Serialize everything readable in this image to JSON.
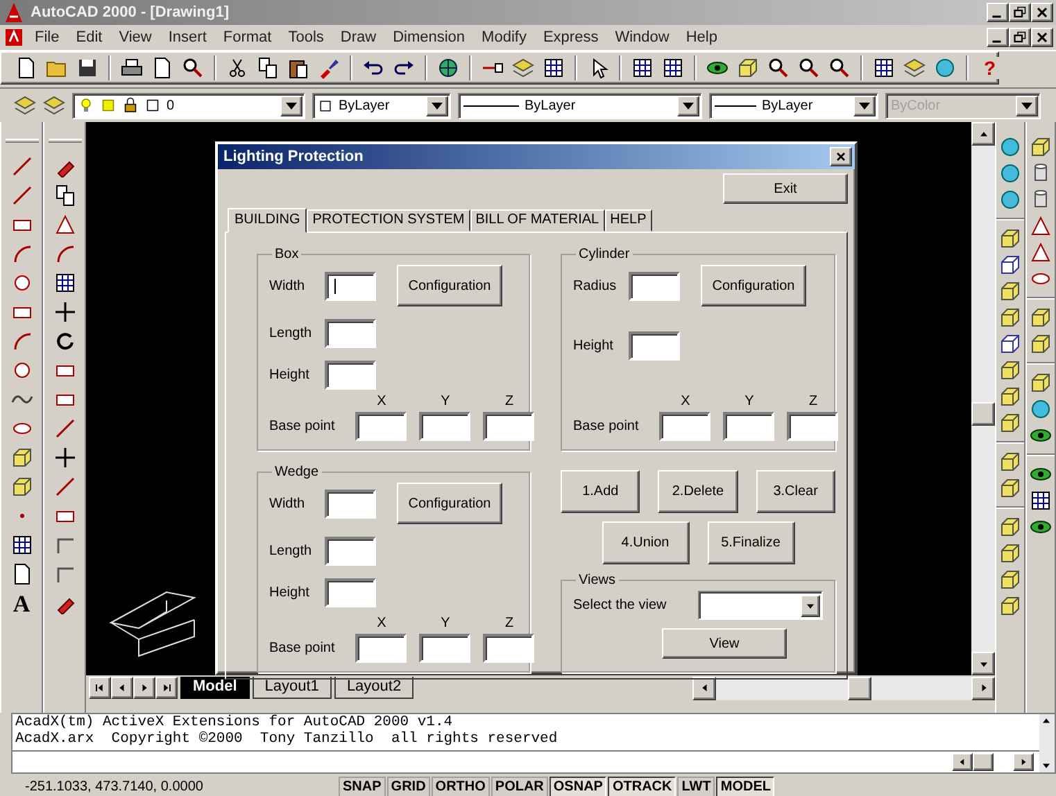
{
  "app_window": {
    "title": "AutoCAD 2000 - [Drawing1]"
  },
  "menu_bar": {
    "items": [
      "File",
      "Edit",
      "View",
      "Insert",
      "Format",
      "Tools",
      "Draw",
      "Dimension",
      "Modify",
      "Express",
      "Window",
      "Help"
    ]
  },
  "standard_toolbar": {
    "help_button": "?"
  },
  "object_properties_toolbar": {
    "layer": "0",
    "color_setting": "ByLayer",
    "linetype": "ByLayer",
    "lineweight": "ByLayer",
    "plot_style": {
      "value": "ByColor",
      "disabled": true
    }
  },
  "draw_toolbar": {
    "text_button": "A"
  },
  "dialog": {
    "title": "Lighting Protection",
    "exit_button": "Exit",
    "tabs": [
      {
        "label": "BUILDING",
        "selected": true
      },
      {
        "label": "PROTECTION SYSTEM",
        "selected": false
      },
      {
        "label": "BILL OF MATERIAL",
        "selected": false
      },
      {
        "label": "HELP",
        "selected": false
      }
    ],
    "groups": [
      {
        "kind": "shape",
        "title": "Box",
        "fields": [
          {
            "label": "Width",
            "focused": true
          },
          {
            "label": "Length",
            "focused": false
          },
          {
            "label": "Height",
            "focused": false
          }
        ],
        "configuration_button": "Configuration",
        "axis_labels": [
          "X",
          "Y",
          "Z"
        ],
        "base_point_label": "Base point"
      },
      {
        "kind": "shape",
        "title": "Cylinder",
        "fields": [
          {
            "label": "Radius",
            "focused": false
          },
          {
            "label": "Height",
            "focused": false
          }
        ],
        "configuration_button": "Configuration",
        "axis_labels": [
          "X",
          "Y",
          "Z"
        ],
        "base_point_label": "Base point"
      },
      {
        "kind": "shape",
        "title": "Wedge",
        "fields": [
          {
            "label": "Width",
            "focused": false
          },
          {
            "label": "Length",
            "focused": false
          },
          {
            "label": "Height",
            "focused": false
          }
        ],
        "configuration_button": "Configuration",
        "axis_labels": [
          "X",
          "Y",
          "Z"
        ],
        "base_point_label": "Base point"
      }
    ],
    "action_buttons": [
      "1.Add",
      "2.Delete",
      "3.Clear",
      "4.Union",
      "5.Finalize"
    ],
    "views": {
      "title": "Views",
      "label": "Select the view",
      "button": "View"
    }
  },
  "layout_tabs": [
    {
      "label": "Model",
      "selected": true
    },
    {
      "label": "Layout1",
      "selected": false
    },
    {
      "label": "Layout2",
      "selected": false
    }
  ],
  "command_window": {
    "lines": [
      "AcadX(tm) ActiveX Extensions for AutoCAD 2000 v1.4",
      "AcadX.arx  Copyright ©2000  Tony Tanzillo  all rights reserved"
    ]
  },
  "status_bar": {
    "coordinates": "-251.1033, 473.7140, 0.0000",
    "toggles": [
      {
        "label": "SNAP",
        "on": false
      },
      {
        "label": "GRID",
        "on": false
      },
      {
        "label": "ORTHO",
        "on": false
      },
      {
        "label": "POLAR",
        "on": false
      },
      {
        "label": "OSNAP",
        "on": true
      },
      {
        "label": "OTRACK",
        "on": true
      },
      {
        "label": "LWT",
        "on": false
      },
      {
        "label": "MODEL",
        "on": true
      }
    ]
  }
}
